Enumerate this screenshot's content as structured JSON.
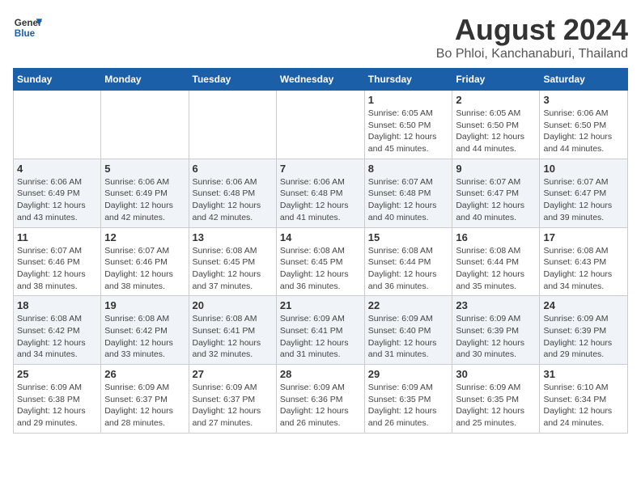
{
  "header": {
    "logo_line1": "General",
    "logo_line2": "Blue",
    "title": "August 2024",
    "subtitle": "Bo Phloi, Kanchanaburi, Thailand"
  },
  "days_of_week": [
    "Sunday",
    "Monday",
    "Tuesday",
    "Wednesday",
    "Thursday",
    "Friday",
    "Saturday"
  ],
  "weeks": [
    [
      {
        "num": "",
        "detail": ""
      },
      {
        "num": "",
        "detail": ""
      },
      {
        "num": "",
        "detail": ""
      },
      {
        "num": "",
        "detail": ""
      },
      {
        "num": "1",
        "detail": "Sunrise: 6:05 AM\nSunset: 6:50 PM\nDaylight: 12 hours\nand 45 minutes."
      },
      {
        "num": "2",
        "detail": "Sunrise: 6:05 AM\nSunset: 6:50 PM\nDaylight: 12 hours\nand 44 minutes."
      },
      {
        "num": "3",
        "detail": "Sunrise: 6:06 AM\nSunset: 6:50 PM\nDaylight: 12 hours\nand 44 minutes."
      }
    ],
    [
      {
        "num": "4",
        "detail": "Sunrise: 6:06 AM\nSunset: 6:49 PM\nDaylight: 12 hours\nand 43 minutes."
      },
      {
        "num": "5",
        "detail": "Sunrise: 6:06 AM\nSunset: 6:49 PM\nDaylight: 12 hours\nand 42 minutes."
      },
      {
        "num": "6",
        "detail": "Sunrise: 6:06 AM\nSunset: 6:48 PM\nDaylight: 12 hours\nand 42 minutes."
      },
      {
        "num": "7",
        "detail": "Sunrise: 6:06 AM\nSunset: 6:48 PM\nDaylight: 12 hours\nand 41 minutes."
      },
      {
        "num": "8",
        "detail": "Sunrise: 6:07 AM\nSunset: 6:48 PM\nDaylight: 12 hours\nand 40 minutes."
      },
      {
        "num": "9",
        "detail": "Sunrise: 6:07 AM\nSunset: 6:47 PM\nDaylight: 12 hours\nand 40 minutes."
      },
      {
        "num": "10",
        "detail": "Sunrise: 6:07 AM\nSunset: 6:47 PM\nDaylight: 12 hours\nand 39 minutes."
      }
    ],
    [
      {
        "num": "11",
        "detail": "Sunrise: 6:07 AM\nSunset: 6:46 PM\nDaylight: 12 hours\nand 38 minutes."
      },
      {
        "num": "12",
        "detail": "Sunrise: 6:07 AM\nSunset: 6:46 PM\nDaylight: 12 hours\nand 38 minutes."
      },
      {
        "num": "13",
        "detail": "Sunrise: 6:08 AM\nSunset: 6:45 PM\nDaylight: 12 hours\nand 37 minutes."
      },
      {
        "num": "14",
        "detail": "Sunrise: 6:08 AM\nSunset: 6:45 PM\nDaylight: 12 hours\nand 36 minutes."
      },
      {
        "num": "15",
        "detail": "Sunrise: 6:08 AM\nSunset: 6:44 PM\nDaylight: 12 hours\nand 36 minutes."
      },
      {
        "num": "16",
        "detail": "Sunrise: 6:08 AM\nSunset: 6:44 PM\nDaylight: 12 hours\nand 35 minutes."
      },
      {
        "num": "17",
        "detail": "Sunrise: 6:08 AM\nSunset: 6:43 PM\nDaylight: 12 hours\nand 34 minutes."
      }
    ],
    [
      {
        "num": "18",
        "detail": "Sunrise: 6:08 AM\nSunset: 6:42 PM\nDaylight: 12 hours\nand 34 minutes."
      },
      {
        "num": "19",
        "detail": "Sunrise: 6:08 AM\nSunset: 6:42 PM\nDaylight: 12 hours\nand 33 minutes."
      },
      {
        "num": "20",
        "detail": "Sunrise: 6:08 AM\nSunset: 6:41 PM\nDaylight: 12 hours\nand 32 minutes."
      },
      {
        "num": "21",
        "detail": "Sunrise: 6:09 AM\nSunset: 6:41 PM\nDaylight: 12 hours\nand 31 minutes."
      },
      {
        "num": "22",
        "detail": "Sunrise: 6:09 AM\nSunset: 6:40 PM\nDaylight: 12 hours\nand 31 minutes."
      },
      {
        "num": "23",
        "detail": "Sunrise: 6:09 AM\nSunset: 6:39 PM\nDaylight: 12 hours\nand 30 minutes."
      },
      {
        "num": "24",
        "detail": "Sunrise: 6:09 AM\nSunset: 6:39 PM\nDaylight: 12 hours\nand 29 minutes."
      }
    ],
    [
      {
        "num": "25",
        "detail": "Sunrise: 6:09 AM\nSunset: 6:38 PM\nDaylight: 12 hours\nand 29 minutes."
      },
      {
        "num": "26",
        "detail": "Sunrise: 6:09 AM\nSunset: 6:37 PM\nDaylight: 12 hours\nand 28 minutes."
      },
      {
        "num": "27",
        "detail": "Sunrise: 6:09 AM\nSunset: 6:37 PM\nDaylight: 12 hours\nand 27 minutes."
      },
      {
        "num": "28",
        "detail": "Sunrise: 6:09 AM\nSunset: 6:36 PM\nDaylight: 12 hours\nand 26 minutes."
      },
      {
        "num": "29",
        "detail": "Sunrise: 6:09 AM\nSunset: 6:35 PM\nDaylight: 12 hours\nand 26 minutes."
      },
      {
        "num": "30",
        "detail": "Sunrise: 6:09 AM\nSunset: 6:35 PM\nDaylight: 12 hours\nand 25 minutes."
      },
      {
        "num": "31",
        "detail": "Sunrise: 6:10 AM\nSunset: 6:34 PM\nDaylight: 12 hours\nand 24 minutes."
      }
    ]
  ]
}
